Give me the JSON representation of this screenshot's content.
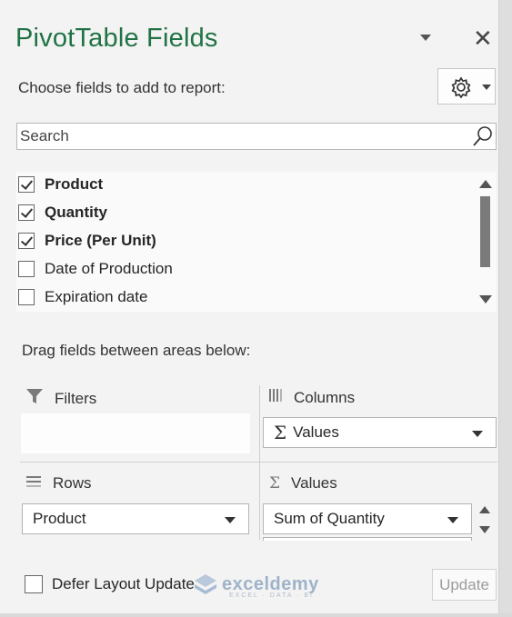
{
  "header": {
    "title": "PivotTable Fields"
  },
  "toolbar": {
    "choose_label": "Choose fields to add to report:"
  },
  "search": {
    "placeholder": "Search",
    "value": ""
  },
  "fields": [
    {
      "label": "Product",
      "checked": true,
      "bold": true
    },
    {
      "label": "Quantity",
      "checked": true,
      "bold": true
    },
    {
      "label": "Price (Per Unit)",
      "checked": true,
      "bold": true
    },
    {
      "label": "Date of Production",
      "checked": false,
      "bold": false
    },
    {
      "label": "Expiration date",
      "checked": false,
      "bold": false
    }
  ],
  "areas": {
    "instruction": "Drag fields between areas below:",
    "filters": {
      "label": "Filters"
    },
    "columns": {
      "label": "Columns",
      "items": [
        {
          "label": "Values",
          "sigma": "Σ"
        }
      ]
    },
    "rows": {
      "label": "Rows",
      "items": [
        {
          "label": "Product"
        }
      ]
    },
    "values": {
      "label": "Values",
      "sigma": "Σ",
      "items": [
        {
          "label": "Sum of Quantity"
        }
      ]
    }
  },
  "footer": {
    "defer_label": "Defer Layout Update",
    "defer_checked": false,
    "update_label": "Update"
  },
  "watermark": {
    "name": "exceldemy",
    "tagline": "EXCEL · DATA · BI"
  },
  "colors": {
    "accent": "#217346",
    "panel": "#f3f3f3"
  }
}
